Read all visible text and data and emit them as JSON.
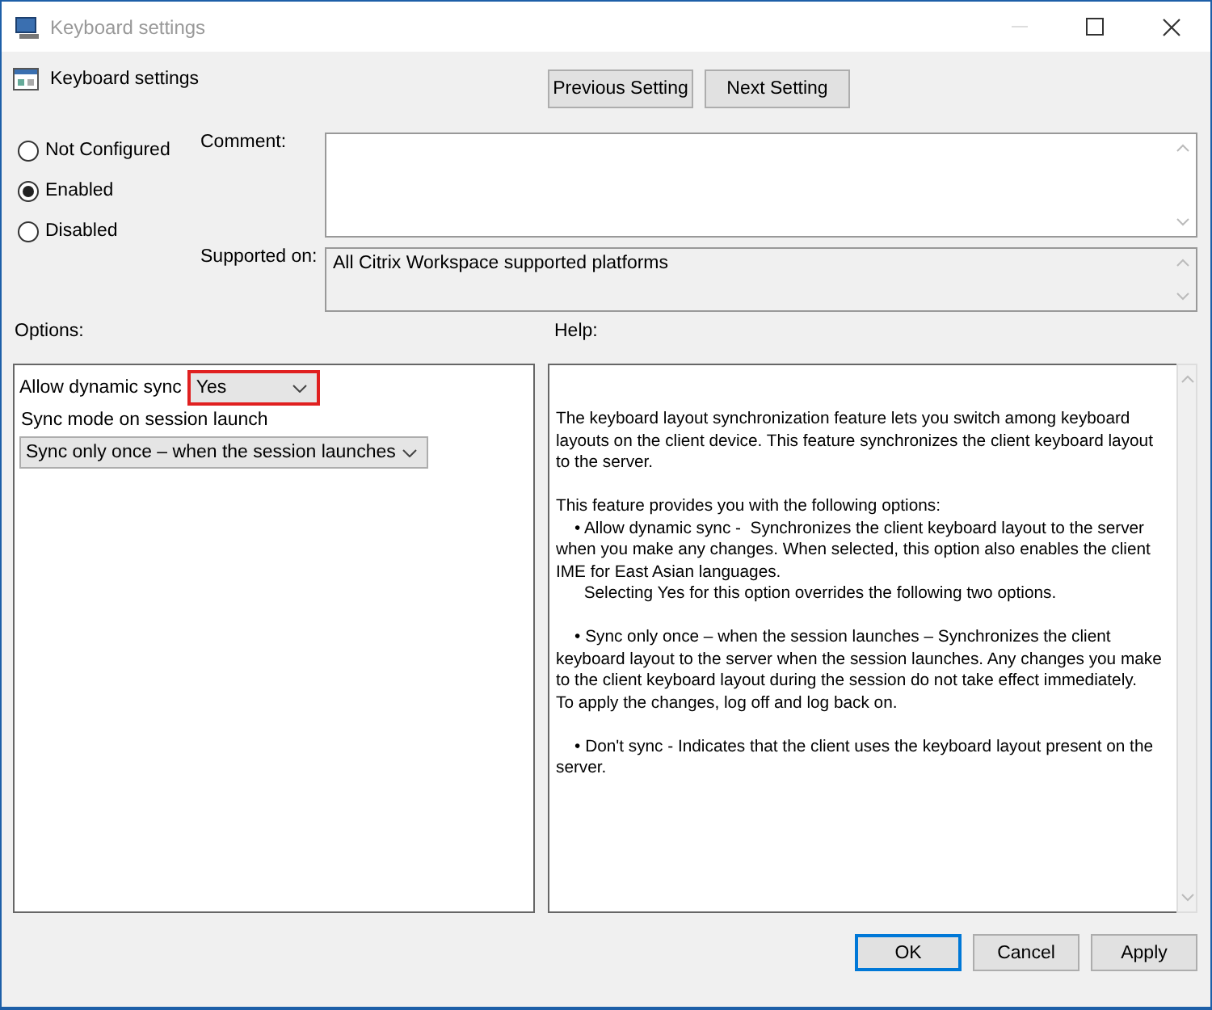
{
  "window": {
    "title": "Keyboard settings"
  },
  "header": {
    "title": "Keyboard settings",
    "buttons": [
      "Previous Setting",
      "Next Setting"
    ]
  },
  "state_options": [
    {
      "label": "Not Configured",
      "selected": false
    },
    {
      "label": "Enabled",
      "selected": true
    },
    {
      "label": "Disabled",
      "selected": false
    }
  ],
  "comment": {
    "label": "Comment:"
  },
  "supported_on": {
    "label": "Supported on:",
    "value": "All Citrix Workspace supported platforms"
  },
  "options": {
    "title": "Options:",
    "items": [
      {
        "kind": "inline-dropdown",
        "label": "Allow dynamic sync",
        "value": "Yes",
        "highlighted": true
      },
      {
        "kind": "label",
        "label": "Sync mode on session launch"
      },
      {
        "kind": "dropdown",
        "value": "Sync only once – when the session launches",
        "highlighted": false
      }
    ]
  },
  "help": {
    "title": "Help:",
    "paragraphs": [
      "The keyboard layout synchronization feature lets you switch among keyboard\nlayouts on the client device. This feature synchronizes the client keyboard layout\nto the server.",
      "This feature provides you with the following options:\n    • Allow dynamic sync -  Synchronizes the client keyboard layout to the server\nwhen you make any changes. When selected, this option also enables the client\nIME for East Asian languages.\n      Selecting Yes for this option overrides the following two options.",
      "    • Sync only once – when the session launches – Synchronizes the client\nkeyboard layout to the server when the session launches. Any changes you make\nto the client keyboard layout during the session do not take effect immediately.\nTo apply the changes, log off and log back on.",
      "    • Don't sync - Indicates that the client uses the keyboard layout present on the\nserver."
    ]
  },
  "footer_buttons": [
    {
      "label": "OK",
      "selected": true
    },
    {
      "label": "Cancel",
      "selected": false
    },
    {
      "label": "Apply",
      "selected": false
    }
  ]
}
